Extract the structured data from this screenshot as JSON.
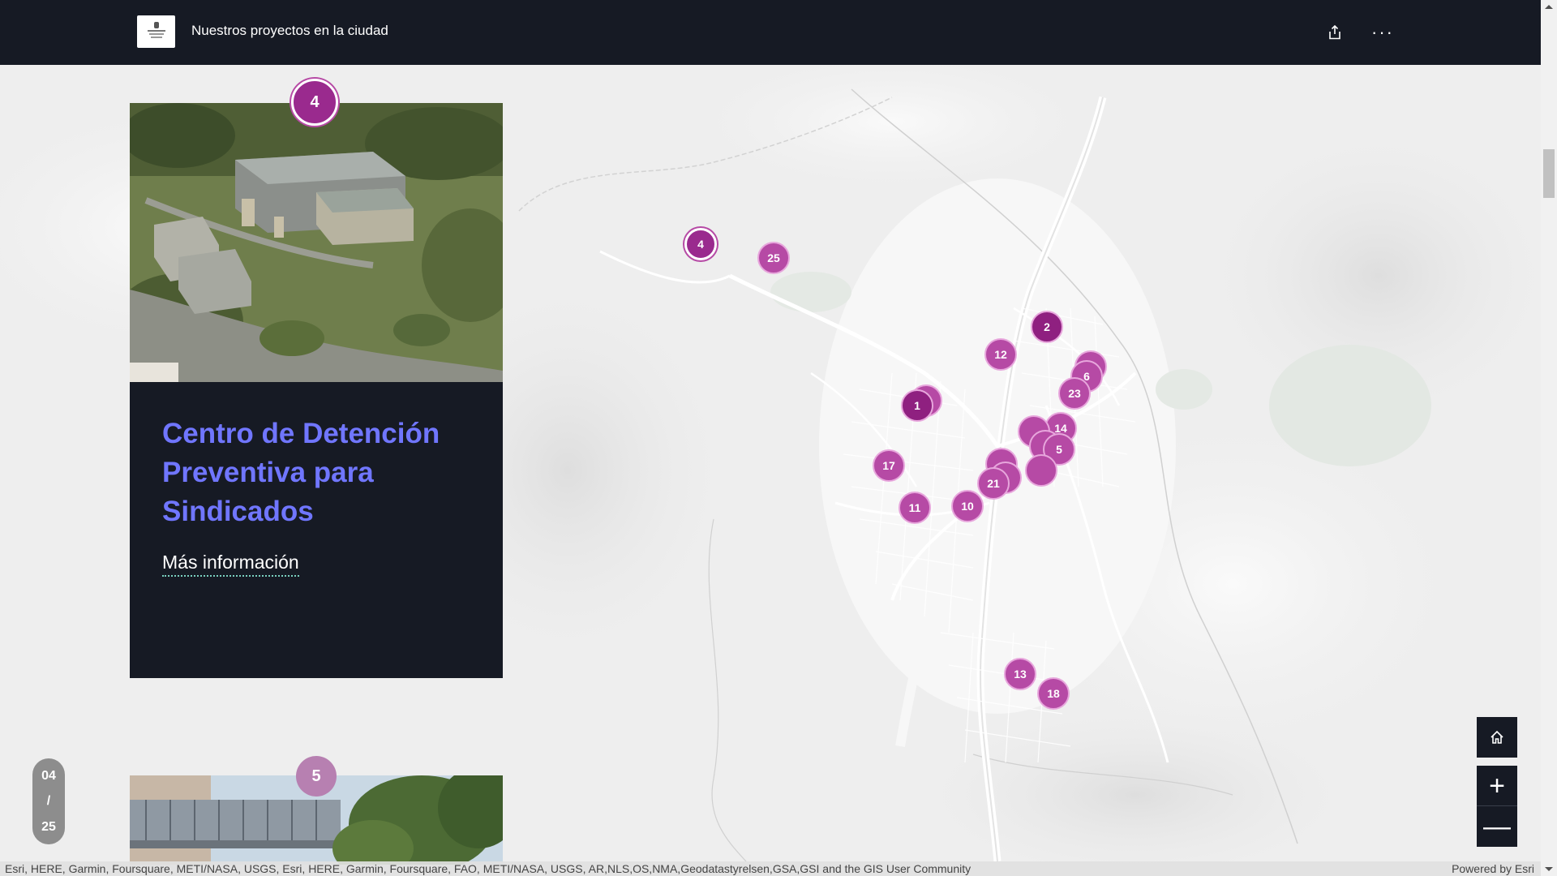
{
  "header": {
    "title": "Nuestros proyectos en la ciudad",
    "share_icon": "share-icon",
    "more_icon": "more-options-icon",
    "more_label": "···"
  },
  "cards": [
    {
      "number": "4",
      "title": "Centro de Detención Preventiva para Sindicados",
      "link_label": "Más información"
    },
    {
      "number": "5"
    }
  ],
  "progress": {
    "current": "04",
    "separator": "/",
    "total": "25"
  },
  "map": {
    "marker_color": "#b64aa5",
    "markers": [
      {
        "label": "4",
        "active": true
      },
      {
        "label": "25"
      },
      {
        "label": "2",
        "dark": true
      },
      {
        "label": "12"
      },
      {
        "label": "6"
      },
      {
        "label": "23"
      },
      {
        "label": "1",
        "dark": true
      },
      {
        "label": "14"
      },
      {
        "label": "5"
      },
      {
        "label": "17"
      },
      {
        "label": "21"
      },
      {
        "label": "10"
      },
      {
        "label": "11"
      },
      {
        "label": "13"
      },
      {
        "label": "18"
      }
    ],
    "controls": {
      "home_icon": "home-icon",
      "zoom_in_label": "+",
      "zoom_out_label": "—"
    }
  },
  "attribution": {
    "text": "Esri, HERE, Garmin, Foursquare, METI/NASA, USGS, Esri, HERE, Garmin, Foursquare, FAO, METI/NASA, USGS, AR,NLS,OS,NMA,Geodatastyrelsen,GSA,GSI and the GIS User Community",
    "powered_by": "Powered by Esri"
  },
  "colors": {
    "header_bg": "#161a24",
    "title_accent": "#7076ff",
    "link_underline": "#7ad1c0"
  }
}
